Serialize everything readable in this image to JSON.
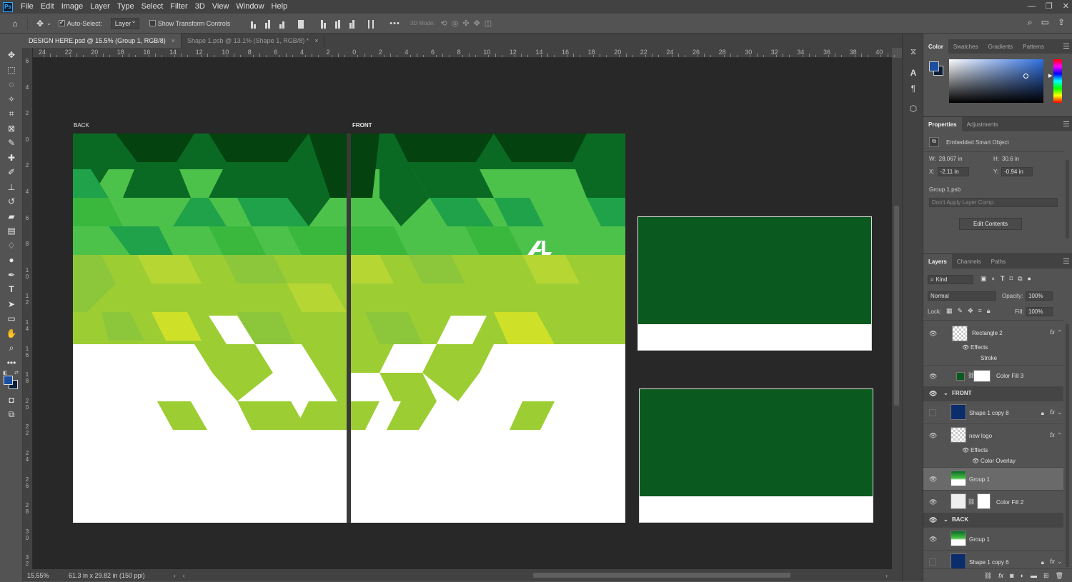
{
  "menu": [
    "File",
    "Edit",
    "Image",
    "Layer",
    "Type",
    "Select",
    "Filter",
    "3D",
    "View",
    "Window",
    "Help"
  ],
  "app_logo": "Ps",
  "options": {
    "auto_select_label": "Auto-Select:",
    "auto_select_checked": true,
    "auto_select_target": "Layer",
    "show_transform_label": "Show Transform Controls",
    "three_d_mode_label": "3D Mode:",
    "more_label": "•••"
  },
  "tabs": [
    {
      "label": "DESIGN HERE.psd @ 15.5% (Group 1, RGB/8)",
      "close": "×",
      "active": true
    },
    {
      "label": "Shape 1.psb @ 13.1% (Shape 1, RGB/8) *",
      "close": "×",
      "active": false
    }
  ],
  "ruler_h": [
    "24",
    "22",
    "20",
    "18",
    "16",
    "14",
    "12",
    "10",
    "8",
    "6",
    "4",
    "2",
    "0",
    "2",
    "4",
    "6",
    "8",
    "10",
    "12",
    "14",
    "16",
    "18",
    "20",
    "22",
    "24",
    "26",
    "28",
    "30",
    "32",
    "34",
    "36",
    "38",
    "40"
  ],
  "ruler_v": [
    "6",
    "4",
    "2",
    "0",
    "2",
    "4",
    "6",
    "8",
    "1 0",
    "1 2",
    "1 4",
    "1 6",
    "1 8",
    "2 0",
    "2 2",
    "2 4",
    "2 6",
    "2 8",
    "3 0",
    "3 2"
  ],
  "canvas": {
    "back_label": "BACK",
    "front_label": "FRONT",
    "colors": {
      "dark_green": "#0a5a1f",
      "darkest_green": "#04420f",
      "mid_green": "#1fa24a",
      "light_green": "#4dc24a",
      "lime": "#9ccd33",
      "yellow_green": "#cfe028",
      "white": "#ffffff",
      "pasteboard": "#282828"
    }
  },
  "status": {
    "zoom": "15.55%",
    "doc_info": "61.3 in x 29.82 in (150 ppi)"
  },
  "color_panel": {
    "tabs": [
      "Color",
      "Swatches",
      "Gradients",
      "Patterns"
    ],
    "foreground": "#1d4fa0",
    "background": "#0b1f3a"
  },
  "properties": {
    "tabs": [
      "Properties",
      "Adjustments"
    ],
    "type": "Embedded Smart Object",
    "w_label": "W:",
    "w": "28.067 in",
    "h_label": "H:",
    "h": "30.6 in",
    "x_label": "X:",
    "x": "-2.11 in",
    "y_label": "Y:",
    "y": "-0.94 in",
    "source": "Group 1.psb",
    "layer_comp": "Don't Apply Layer Comp",
    "edit_button": "Edit Contents"
  },
  "layers_panel": {
    "tabs": [
      "Layers",
      "Channels",
      "Paths"
    ],
    "kind": "Kind",
    "blend_mode": "Normal",
    "opacity_label": "Opacity:",
    "opacity": "100%",
    "lock_label": "Lock:",
    "fill_label": "Fill:",
    "fill": "100%",
    "layers": [
      {
        "name": "Rectangle 2",
        "fx": "fx"
      },
      {
        "name": "Effects"
      },
      {
        "name": "Stroke"
      },
      {
        "name": "Color Fill 3"
      },
      {
        "name": "FRONT"
      },
      {
        "name": "Shape 1 copy 8",
        "fx": "fx"
      },
      {
        "name": "new logo",
        "fx": "fx"
      },
      {
        "name": "Effects"
      },
      {
        "name": "Color Overlay"
      },
      {
        "name": "Group 1"
      },
      {
        "name": "Color Fill 2"
      },
      {
        "name": "BACK"
      },
      {
        "name": "Group 1"
      },
      {
        "name": "Shape 1 copy 6",
        "fx": "fx"
      }
    ]
  }
}
